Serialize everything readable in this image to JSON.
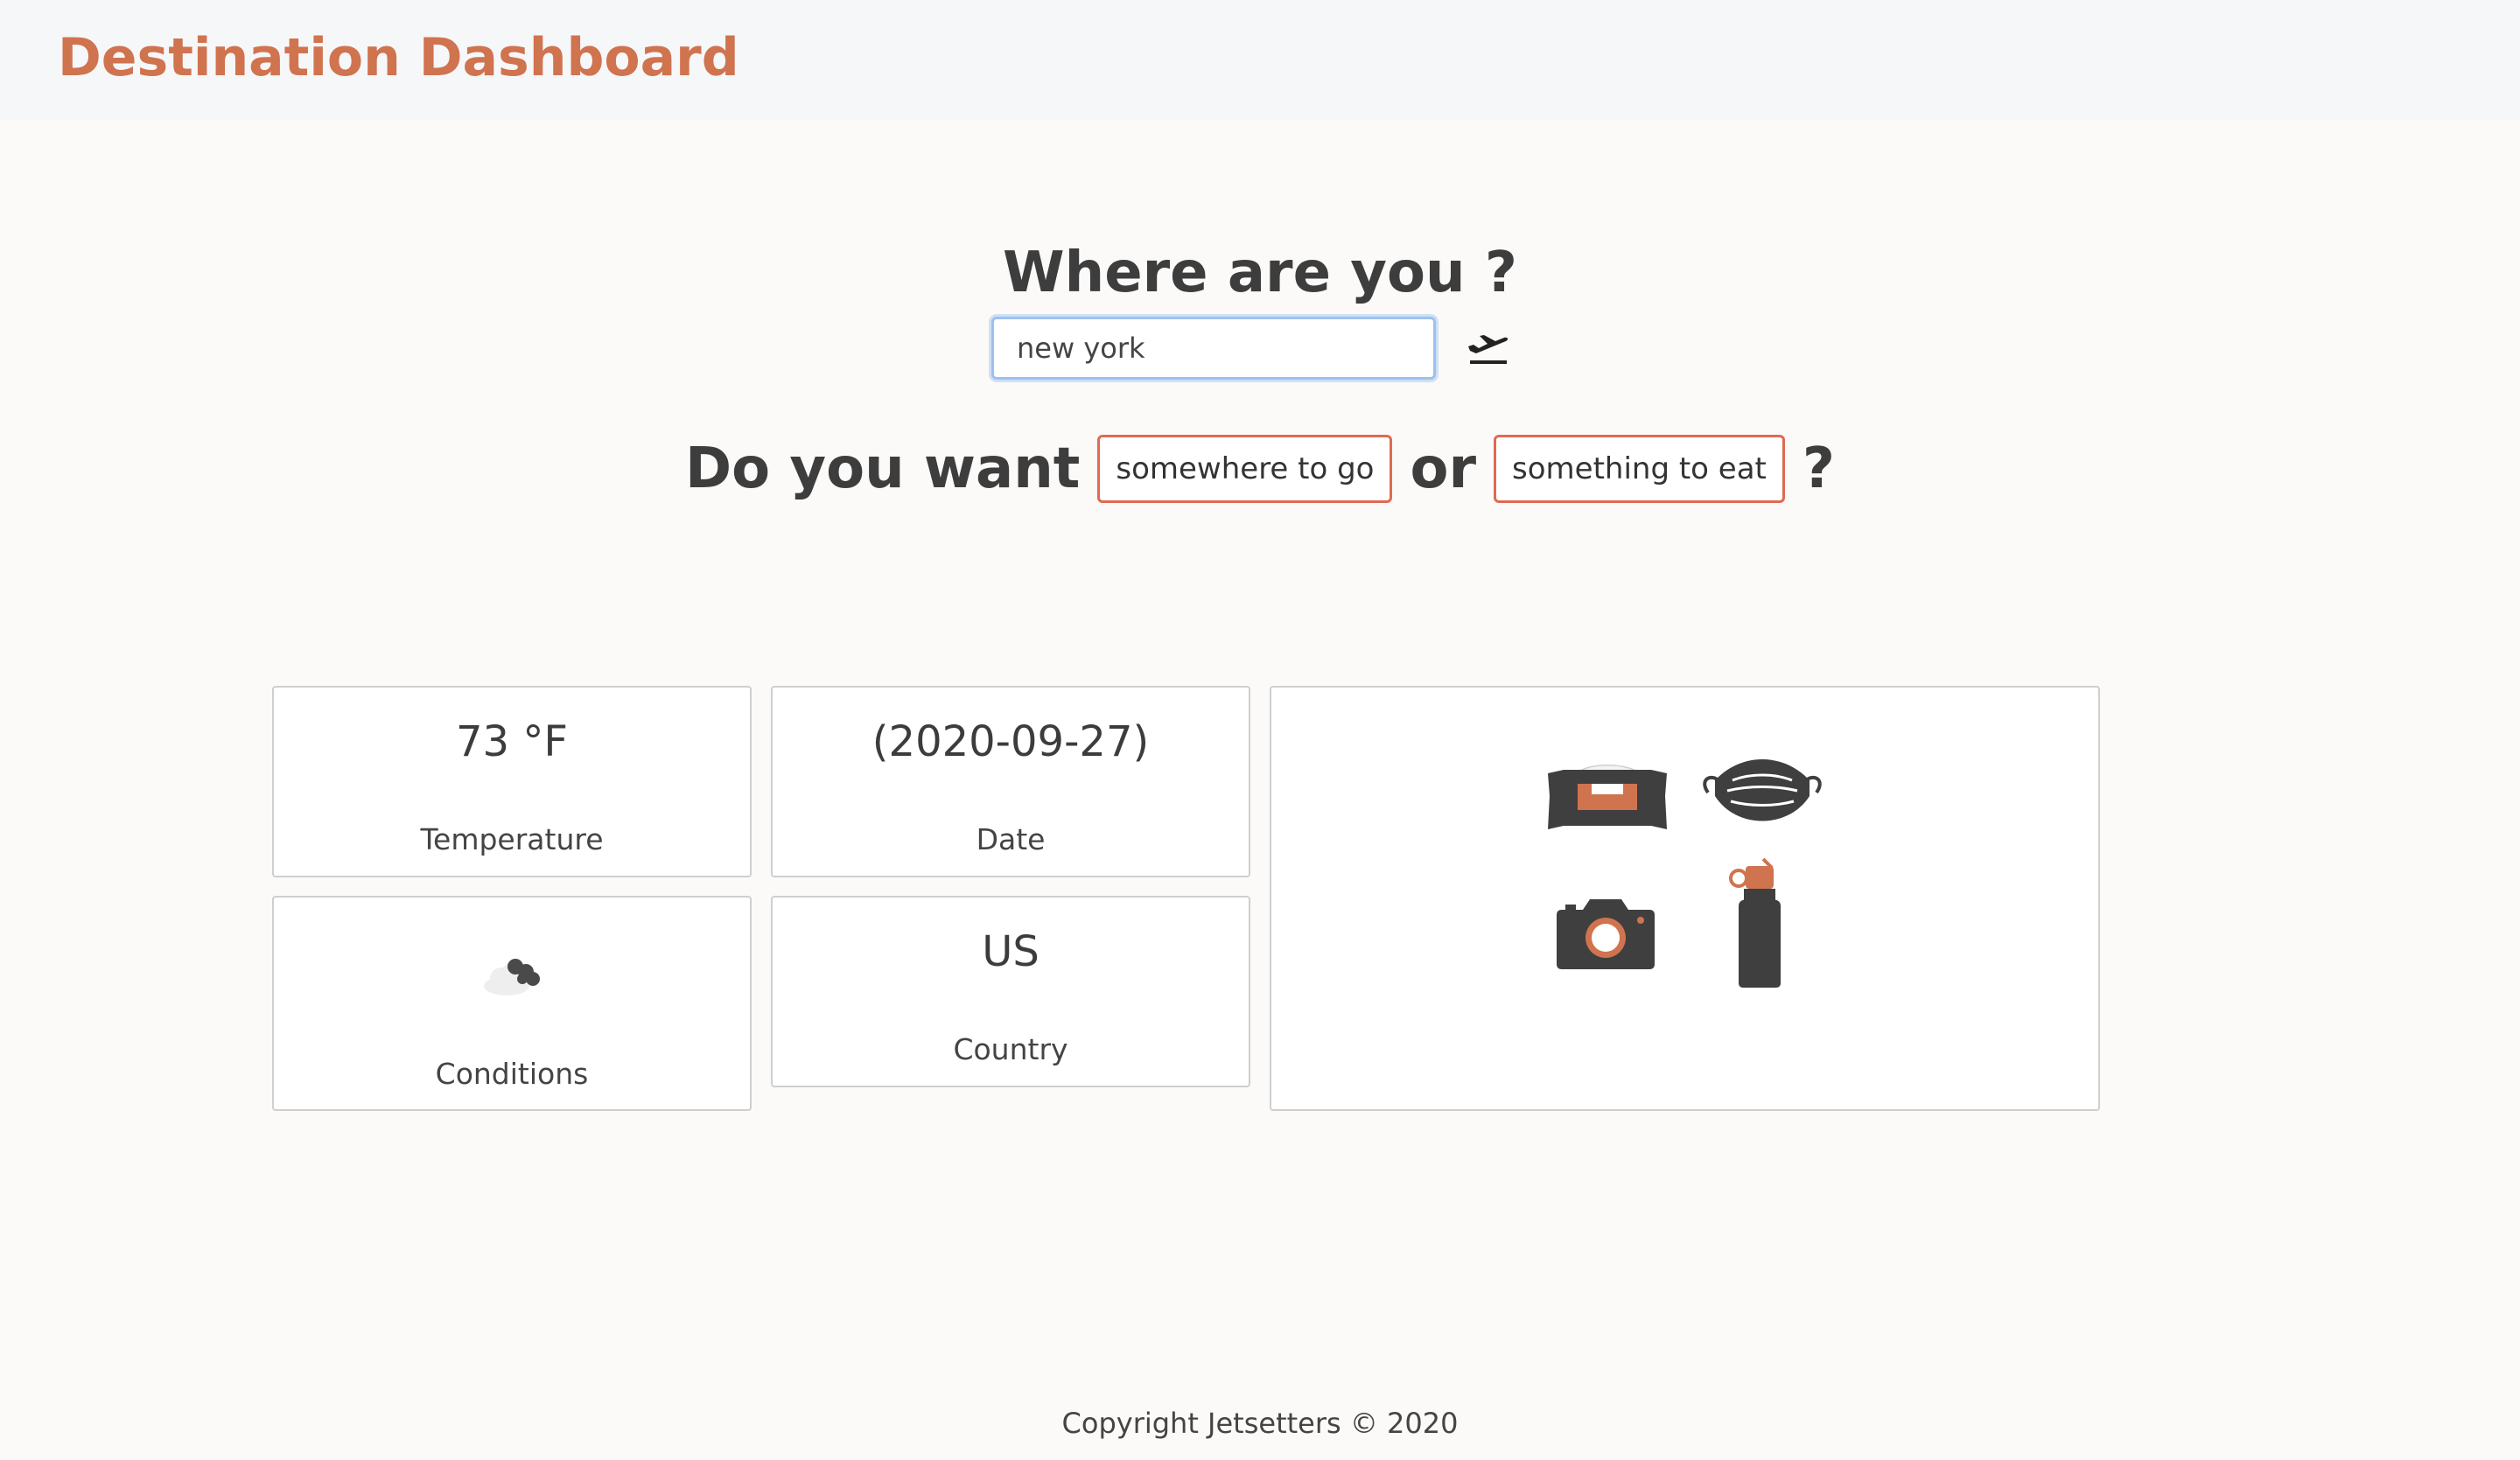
{
  "header": {
    "title": "Destination Dashboard"
  },
  "search": {
    "heading": "Where are you ?",
    "value": "new york",
    "go_icon": "airplane-departure-icon"
  },
  "question": {
    "prefix": "Do you want",
    "option_go": "somewhere to go",
    "connector": "or",
    "option_eat": "something to eat",
    "suffix": "?"
  },
  "cards": {
    "temperature": {
      "value": "73 °F",
      "label": "Temperature"
    },
    "date": {
      "value": "(2020-09-27)",
      "label": "Date"
    },
    "conditions": {
      "icon": "cloudy-icon",
      "label": "Conditions"
    },
    "country": {
      "value": "US",
      "label": "Country"
    },
    "packing": {
      "items": [
        "tissue-box-icon",
        "face-mask-icon",
        "camera-icon",
        "water-bottle-icon"
      ]
    }
  },
  "colors": {
    "brand": "#d0734f",
    "option_border": "#e06a52",
    "input_focus": "#9cc1ee",
    "icon_dark": "#404040"
  },
  "footer": {
    "text": "Copyright Jetsetters © 2020"
  }
}
